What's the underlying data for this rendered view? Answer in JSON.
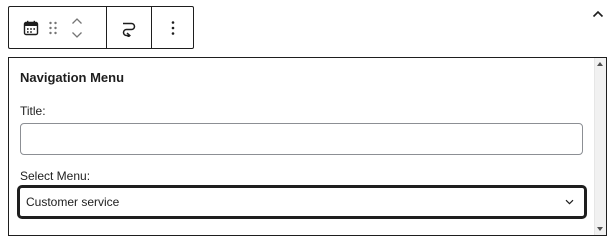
{
  "toolbar": {
    "buttons": [
      {
        "name": "block-type",
        "icon": "calendar-icon"
      },
      {
        "name": "drag",
        "icon": "drag-handle-icon"
      },
      {
        "name": "move-up",
        "icon": "chevron-up-icon"
      },
      {
        "name": "move-down",
        "icon": "chevron-down-icon"
      },
      {
        "name": "transform",
        "icon": "transform-loop-icon"
      },
      {
        "name": "options",
        "icon": "more-vertical-icon"
      }
    ]
  },
  "collapse": {
    "icon": "chevron-up-icon"
  },
  "widget": {
    "title": "Navigation Menu",
    "title_field": {
      "label": "Title:",
      "value": "",
      "placeholder": ""
    },
    "menu_field": {
      "label": "Select Menu:",
      "selected": "Customer service"
    }
  },
  "colors": {
    "border": "#1e1e1e",
    "input_border": "#8c8f94",
    "icon": "#1e1e1e",
    "muted_icon": "#757575"
  }
}
